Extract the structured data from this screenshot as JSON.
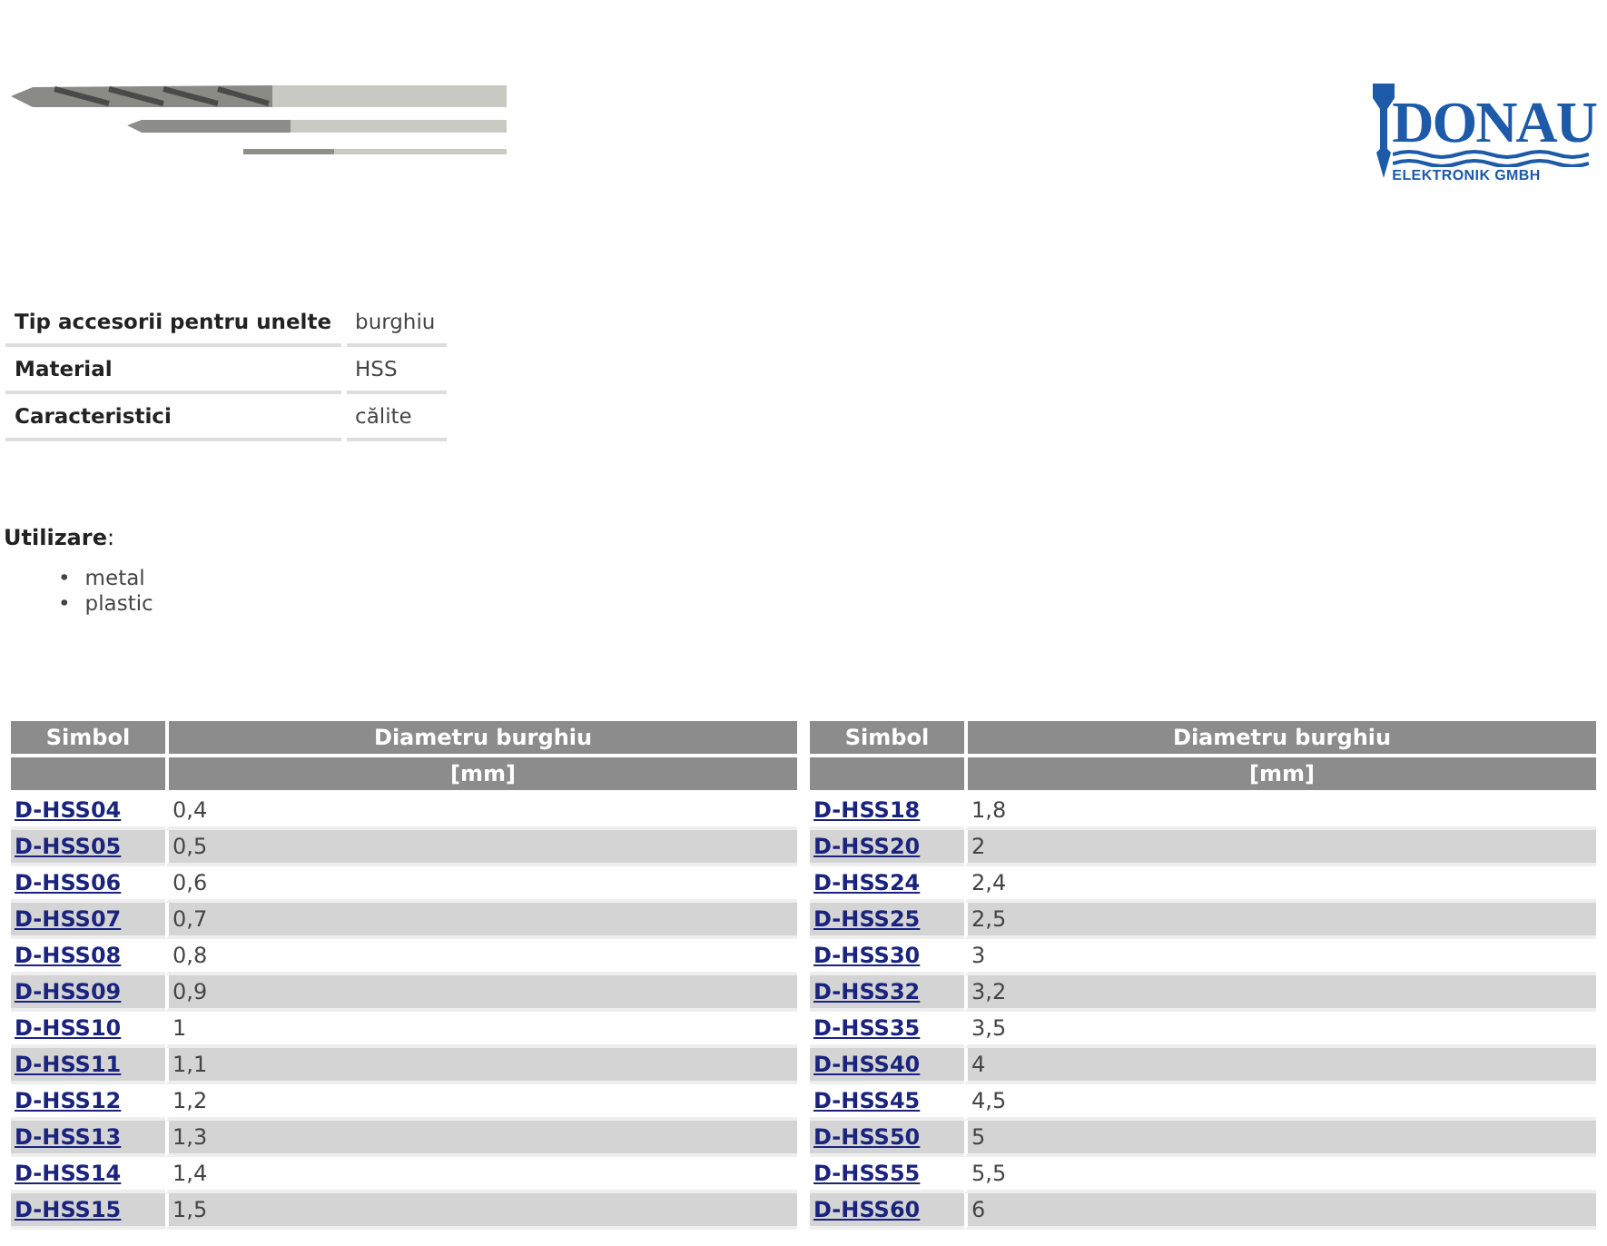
{
  "header": {
    "logo": {
      "name": "DONAU",
      "subtitle": "ELEKTRONIK GMBH"
    }
  },
  "properties": [
    {
      "label": "Tip accesorii pentru unelte",
      "value": "burghiu"
    },
    {
      "label": "Material",
      "value": "HSS"
    },
    {
      "label": "Caracteristici",
      "value": "călite"
    }
  ],
  "usage": {
    "title": "**Utilizare**:",
    "items": [
      {
        "marker": "•",
        "text": "metal"
      },
      {
        "marker": "•",
        "text": "plastic"
      }
    ]
  },
  "tables": [
    {
      "columns": [
        "Simbol",
        "Diametru burghiu"
      ],
      "unit": "[mm]",
      "rows": [
        {
          "symbol": "D-HSS04",
          "diameter": "0,4"
        },
        {
          "symbol": "D-HSS05",
          "diameter": "0,5"
        },
        {
          "symbol": "D-HSS06",
          "diameter": "0,6"
        },
        {
          "symbol": "D-HSS07",
          "diameter": "0,7"
        },
        {
          "symbol": "D-HSS08",
          "diameter": "0,8"
        },
        {
          "symbol": "D-HSS09",
          "diameter": "0,9"
        },
        {
          "symbol": "D-HSS10",
          "diameter": "1"
        },
        {
          "symbol": "D-HSS11",
          "diameter": "1,1"
        },
        {
          "symbol": "D-HSS12",
          "diameter": "1,2"
        },
        {
          "symbol": "D-HSS13",
          "diameter": "1,3"
        },
        {
          "symbol": "D-HSS14",
          "diameter": "1,4"
        },
        {
          "symbol": "D-HSS15",
          "diameter": "1,5"
        }
      ]
    },
    {
      "columns": [
        "Simbol",
        "Diametru burghiu"
      ],
      "unit": "[mm]",
      "rows": [
        {
          "symbol": "D-HSS18",
          "diameter": "1,8"
        },
        {
          "symbol": "D-HSS20",
          "diameter": "2"
        },
        {
          "symbol": "D-HSS24",
          "diameter": "2,4"
        },
        {
          "symbol": "D-HSS25",
          "diameter": "2,5"
        },
        {
          "symbol": "D-HSS30",
          "diameter": "3"
        },
        {
          "symbol": "D-HSS32",
          "diameter": "3,2"
        },
        {
          "symbol": "D-HSS35",
          "diameter": "3,5"
        },
        {
          "symbol": "D-HSS40",
          "diameter": "4"
        },
        {
          "symbol": "D-HSS45",
          "diameter": "4,5"
        },
        {
          "symbol": "D-HSS50",
          "diameter": "5"
        },
        {
          "symbol": "D-HSS55",
          "diameter": "5,5"
        },
        {
          "symbol": "D-HSS60",
          "diameter": "6"
        }
      ]
    }
  ]
}
